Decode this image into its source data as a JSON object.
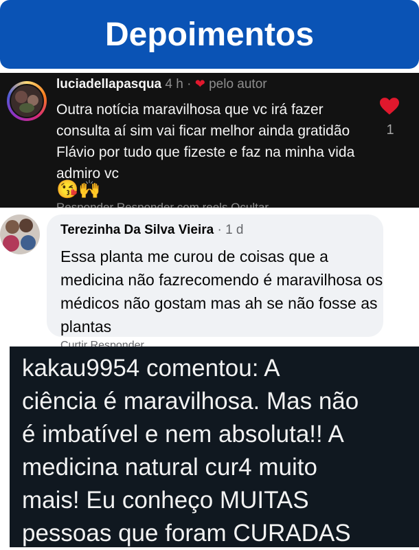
{
  "header": {
    "title": "Depoimentos"
  },
  "instagram_comment": {
    "username": "luciadellapasqua",
    "time": "4 h",
    "separator": "·",
    "liked_by_author": "pelo autor",
    "text": "Outra notícia maravilhosa que vc irá fazer consulta aí sim vai ficar melhor ainda gratidão Flávio por tudo que fizeste e faz na minha vida admiro vc",
    "emojis": "😘🙌",
    "like_count": "1",
    "truncated_actions": "Responder   Responder com reels   Ocultar"
  },
  "facebook_comment": {
    "name": "Terezinha Da Silva Vieira",
    "time": "· 1 d",
    "text": "Essa planta me curou de coisas que a medicina não fazrecomendo é maravilhosa os médicos não gostam mas ah se não fosse as plantas",
    "truncated_actions": "Curtir   Responder"
  },
  "story_comment": {
    "lines": [
      "kakau9954 comentou: A",
      "ciência é maravilhosa.  Mas não",
      "é imbatível e nem absoluta!! A",
      "medicina natural cur4 muito",
      "mais! Eu  conheço MUITAS",
      "pessoas que foram CURADAS"
    ]
  },
  "colors": {
    "title_bg": "#0a53b5",
    "heart": "#e0182d",
    "ig_bg": "#121212",
    "fb_bubble": "#f0f2f5",
    "story_bg": "#101820"
  },
  "icons": {
    "like": "heart-icon",
    "liked_by_author": "heart-icon"
  }
}
